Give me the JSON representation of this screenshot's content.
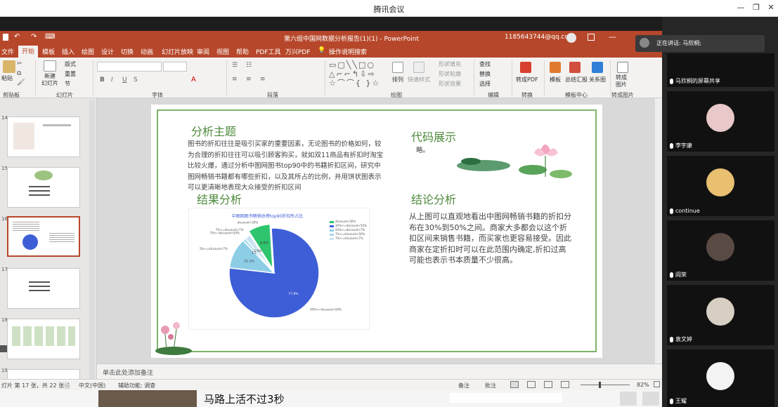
{
  "window": {
    "title": "腾讯会议"
  },
  "ppt": {
    "doc_title": "第六组中国网数据分析报告(1)(1) - PowerPoint",
    "account": "1185643744@qq.com",
    "menu": [
      "文件",
      "开始",
      "模板",
      "插入",
      "绘图",
      "设计",
      "切换",
      "动画",
      "幻灯片放映",
      "审阅",
      "视图",
      "帮助",
      "PDF工具",
      "万兴PDF"
    ],
    "tell_me": "操作说明搜索",
    "ribbon": {
      "paste": "粘贴",
      "new_slide": "新建\n幻灯片",
      "layout": "版式",
      "reset": "重置",
      "section": "节",
      "find": "查找",
      "replace": "替换",
      "select": "选择",
      "arrange": "排列",
      "quick_styles": "快速样式",
      "shape_fill": "形状填充",
      "shape_outline": "形状轮廓",
      "shape_effect": "形状效果",
      "to_pdf": "转成PDF",
      "template": "模板",
      "summary": "总结汇报",
      "relation": "关系图",
      "to_image": "转成\n图片",
      "groups": [
        "剪贴板",
        "幻灯片",
        "字体",
        "段落",
        "绘图",
        "编辑",
        "转换",
        "模板中心",
        "转成图片"
      ]
    },
    "thumb_numbers": [
      "14",
      "15",
      "16",
      "17",
      "18",
      "19"
    ],
    "slide": {
      "h_topic": "分析主题",
      "topic_text": "图书的折扣往往是吸引买家的重要因素，无论图书的价格如何，较为合理的折扣往往可以吸引顾客购买，就如双11商品有折扣时淘宝比较火爆，通过分析中图网图书top90中的书籍折扣区间，研究中图网畅销书籍都有哪些折扣，以及其所占的比例，并用饼状图表示可以更清晰地表现大众接受的折扣区间",
      "h_code": "代码展示",
      "code_text": "略。",
      "h_result": "结果分析",
      "h_conclusion": "结论分析",
      "conclusion_text": "从上图可以直观地看出中图网畅销书籍的折扣分布在30%到50%之间。商家大多都会以这个折扣区间来销售书籍，而买家也更容易接受。因此商家在定折扣时可以在此范围内确定,折扣过高可能也表示书本质量不少很高。"
    },
    "notes": "单击此处添加备注",
    "status": {
      "slide_info": "灯片 第 17 张，共 22 张",
      "lang": "中文(中国)",
      "accessibility": "辅助功能: 调查",
      "notes_btn": "备注",
      "comments_btn": "批注",
      "zoom": "82%"
    },
    "taskbar_text": "马路上活不过3秒"
  },
  "chart_data": {
    "type": "pie",
    "title": "中图网图书畅销总榜top90折扣所占比",
    "categories": [
      "discount<30%",
      "30%<=discount<50%",
      "50%<=discount<7%",
      "7%<=discount<50%",
      "7%<=discount<7%"
    ],
    "values": [
      8.0,
      77.8,
      11.1,
      1.1,
      2.0
    ],
    "slice_labels": [
      "8.0%",
      "77.8%",
      "11.1%",
      "1.1%",
      "2.0%"
    ],
    "callouts": [
      "discount<30%",
      "30%<=discount<50%",
      "5%<=discount<7%",
      "7%<=discount<50%",
      "7%<=discount<7%"
    ],
    "colors": [
      "#2fc46e",
      "#3d5ed6",
      "#8ecde6",
      "#a8d8ee",
      "#c5e3f0"
    ],
    "legend_position": "top-right"
  },
  "participants": {
    "speaking_label": "正在讲话: 马欣桐;",
    "people": [
      {
        "name": "马欣桐的屏幕共享"
      },
      {
        "name": "李宇康"
      },
      {
        "name": "continue"
      },
      {
        "name": "阎荣"
      },
      {
        "name": "袁文婷"
      },
      {
        "name": "王耀"
      }
    ]
  }
}
